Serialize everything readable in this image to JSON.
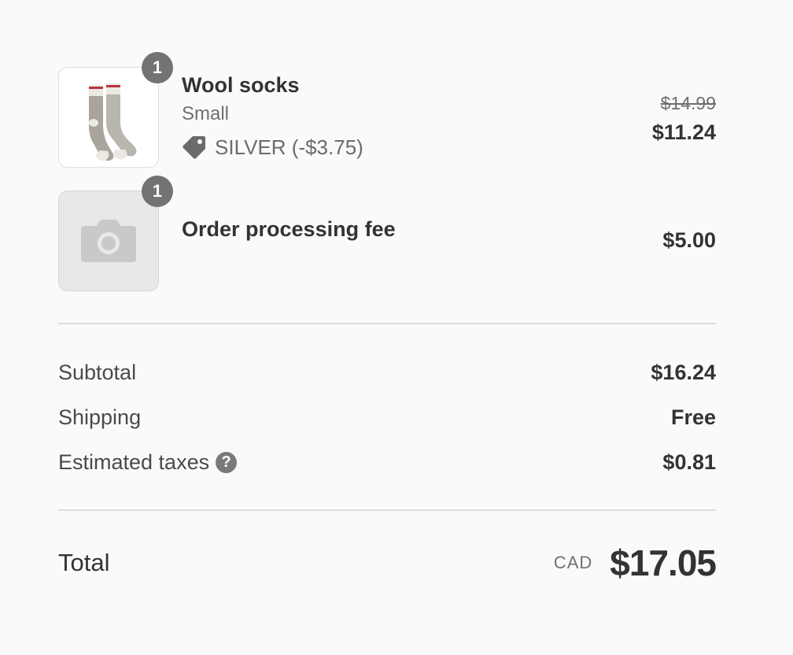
{
  "line_items": [
    {
      "quantity": "1",
      "name": "Wool socks",
      "variant": "Small",
      "discount_label": "SILVER (-$3.75)",
      "original_price": "$14.99",
      "price": "$11.24",
      "image_icon": "wool-socks-image"
    },
    {
      "quantity": "1",
      "name": "Order processing fee",
      "price": "$5.00",
      "image_icon": "camera-icon"
    }
  ],
  "totals": {
    "subtotal_label": "Subtotal",
    "subtotal_value": "$16.24",
    "shipping_label": "Shipping",
    "shipping_value": "Free",
    "taxes_label": "Estimated taxes",
    "taxes_help": "?",
    "taxes_value": "$0.81",
    "total_label": "Total",
    "currency": "CAD",
    "total_value": "$17.05"
  },
  "colors": {
    "background": "#fafafa",
    "badge": "#737373",
    "text": "#333333",
    "muted": "#707070"
  }
}
